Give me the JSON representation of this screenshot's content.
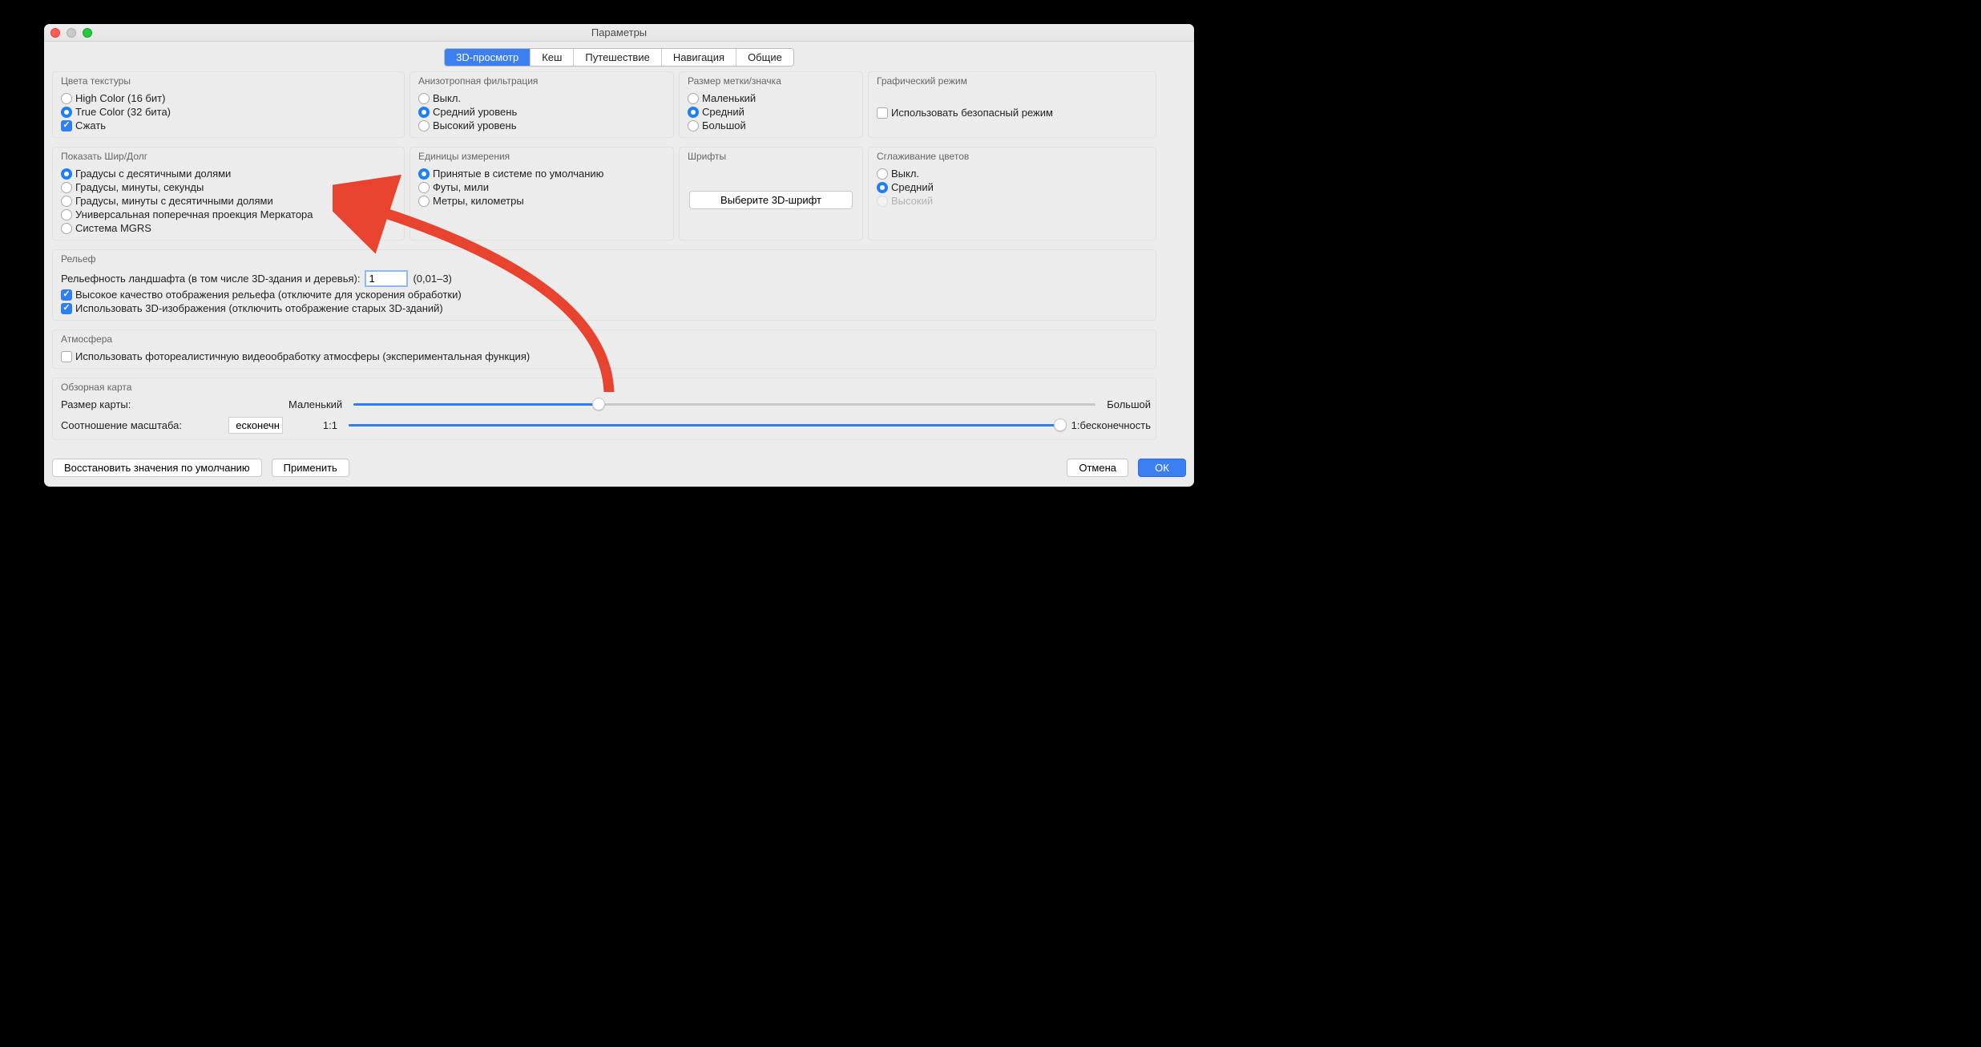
{
  "window": {
    "title": "Параметры"
  },
  "tabs": {
    "items": [
      "3D-просмотр",
      "Кеш",
      "Путешествие",
      "Навигация",
      "Общие"
    ],
    "active": 0
  },
  "groups": {
    "textureColors": {
      "title": "Цвета текстуры",
      "high": "High Color (16 бит)",
      "true": "True Color (32 бита)",
      "compress": "Сжать"
    },
    "aniso": {
      "title": "Анизотропная фильтрация",
      "off": "Выкл.",
      "mid": "Средний уровень",
      "high": "Высокий уровень"
    },
    "iconSize": {
      "title": "Размер метки/значка",
      "small": "Маленький",
      "mid": "Средний",
      "big": "Большой"
    },
    "gfxMode": {
      "title": "Графический режим",
      "safe": "Использовать безопасный режим"
    },
    "latlon": {
      "title": "Показать Шир/Долг",
      "o1": "Градусы с десятичными долями",
      "o2": "Градусы, минуты, секунды",
      "o3": "Градусы, минуты с десятичными долями",
      "o4": "Универсальная поперечная проекция Меркатора",
      "o5": "Система MGRS"
    },
    "units": {
      "title": "Единицы измерения",
      "o1": "Принятые в системе по умолчанию",
      "o2": "Футы, мили",
      "o3": "Метры, километры"
    },
    "fonts": {
      "title": "Шрифты",
      "btn": "Выберите 3D-шрифт"
    },
    "antialias": {
      "title": "Сглаживание цветов",
      "o1": "Выкл.",
      "o2": "Средний",
      "o3": "Высокий"
    },
    "terrain": {
      "title": "Рельеф",
      "exag_label_pre": "Рельефность ландшафта (в том числе 3D-здания и деревья):",
      "exag_value": "1",
      "exag_label_post": "(0,01–3)",
      "hq": "Высокое качество отображения рельефа (отключите для ускорения обработки)",
      "imagery3d": "Использовать 3D-изображения (отключить отображение старых 3D-зданий)"
    },
    "atmosphere": {
      "title": "Атмосфера",
      "photo": "Использовать фотореалистичную видеообработку атмосферы (экспериментальная функция)"
    },
    "overview": {
      "title": "Обзорная карта",
      "size_label": "Размер карты:",
      "small": "Маленький",
      "big": "Большой",
      "zoom_label": "Соотношение масштаба:",
      "zoom_value": "есконечн",
      "r1": "1:1",
      "rinf": "1:бесконечность"
    }
  },
  "footer": {
    "restore": "Восстановить значения по умолчанию",
    "apply": "Применить",
    "cancel": "Отмена",
    "ok": "ОК"
  }
}
